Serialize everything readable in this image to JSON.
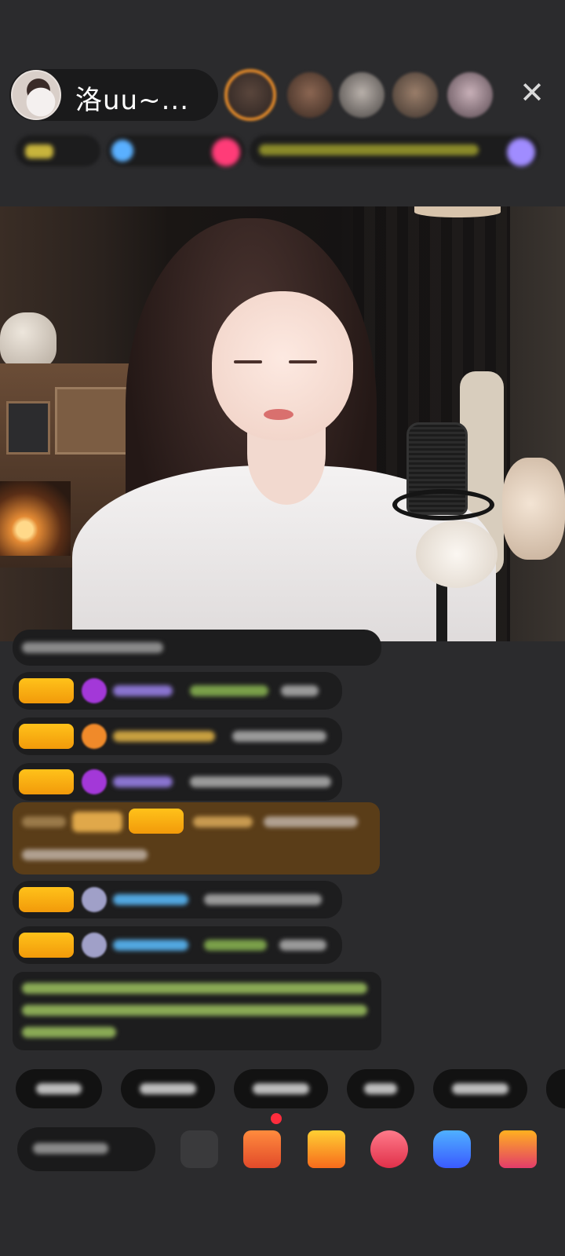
{
  "header": {
    "host_name": "洛uu~...",
    "close_glyph": "✕",
    "viewer_colors": [
      "#6a5448",
      "#8b6652",
      "#9a8c84",
      "#7a6656",
      "#b09aa4"
    ],
    "rank1_border_color": "#e38a2a"
  },
  "info_bar": {
    "accent_pill_color": "#3a3a12",
    "tag_colors": [
      "#c8b43c",
      "#5ab0ff",
      "#ff3c78",
      "#c0b040",
      "#a08cff"
    ]
  },
  "chat": {
    "badge_color": "#f5a90e",
    "name_colors": {
      "purple": "#8a74d0",
      "gold": "#c8a040",
      "blue": "#52a7e0",
      "green": "#9ccc55"
    }
  },
  "bottom_bar": {
    "icons": [
      "emoji-icon",
      "gift-box-icon",
      "vip-gift-icon",
      "heart-icon",
      "game-controller-icon",
      "more-gifts-icon"
    ]
  }
}
